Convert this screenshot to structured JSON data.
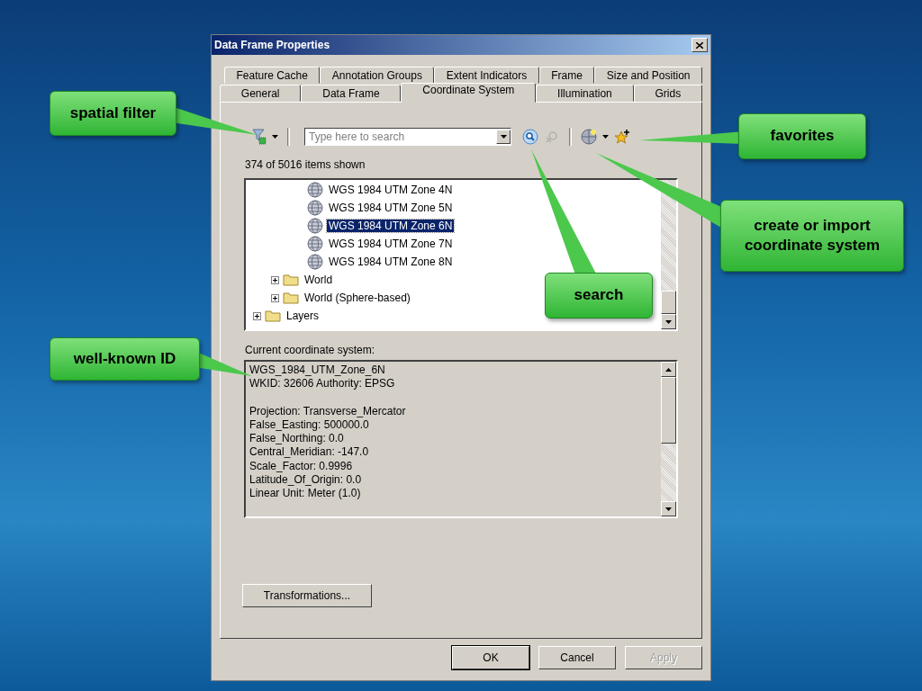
{
  "dialog": {
    "title": "Data Frame Properties"
  },
  "tab_rows": [
    [
      {
        "label": "Feature Cache",
        "selected": false
      },
      {
        "label": "Annotation Groups",
        "selected": false
      },
      {
        "label": "Extent Indicators",
        "selected": false
      },
      {
        "label": "Frame",
        "selected": false
      },
      {
        "label": "Size and Position",
        "selected": false
      }
    ],
    [
      {
        "label": "General",
        "selected": false
      },
      {
        "label": "Data Frame",
        "selected": false
      },
      {
        "label": "Coordinate System",
        "selected": true
      },
      {
        "label": "Illumination",
        "selected": false
      },
      {
        "label": "Grids",
        "selected": false
      }
    ]
  ],
  "search": {
    "placeholder": "Type here to search"
  },
  "items_count": "374 of 5016 items shown",
  "tree": [
    {
      "children": [
        {
          "children": [
            {
              "children": [
                {
                  "kind": "coordinate_system",
                  "label": "WGS 1984 UTM Zone 4N",
                  "selected": false
                },
                {
                  "kind": "coordinate_system",
                  "label": "WGS 1984 UTM Zone 5N",
                  "selected": false
                },
                {
                  "kind": "coordinate_system",
                  "label": "WGS 1984 UTM Zone 6N",
                  "selected": true
                },
                {
                  "kind": "coordinate_system",
                  "label": "WGS 1984 UTM Zone 7N",
                  "selected": false
                },
                {
                  "kind": "coordinate_system",
                  "label": "WGS 1984 UTM Zone 8N",
                  "selected": false
                }
              ]
            }
          ]
        },
        {
          "kind": "folder",
          "label": "World",
          "expanded": false,
          "selected": false
        },
        {
          "kind": "folder",
          "label": "World (Sphere-based)",
          "expanded": false,
          "selected": false
        }
      ]
    },
    {
      "kind": "folder",
      "label": "Layers",
      "expanded": false,
      "selected": false
    }
  ],
  "current_label": "Current coordinate system:",
  "details": [
    [
      "WGS_1984_UTM_Zone_6N",
      "WKID: 32606 Authority: EPSG"
    ],
    [
      "Projection: Transverse_Mercator",
      "False_Easting: 500000.0",
      "False_Northing: 0.0",
      "Central_Meridian: -147.0",
      "Scale_Factor: 0.9996",
      "Latitude_Of_Origin: 0.0",
      "Linear Unit: Meter (1.0)"
    ]
  ],
  "transformations_button": {
    "label": "Transformations...",
    "disabled": false
  },
  "buttons": [
    {
      "label": "OK",
      "disabled": false
    },
    {
      "label": "Cancel",
      "disabled": false
    },
    {
      "label": "Apply",
      "disabled": true
    }
  ],
  "callouts": [
    {
      "label": "spatial filter"
    },
    {
      "label": "favorites"
    },
    {
      "label": "create or import coordinate system"
    },
    {
      "label": "search"
    },
    {
      "label": "well-known ID"
    }
  ]
}
